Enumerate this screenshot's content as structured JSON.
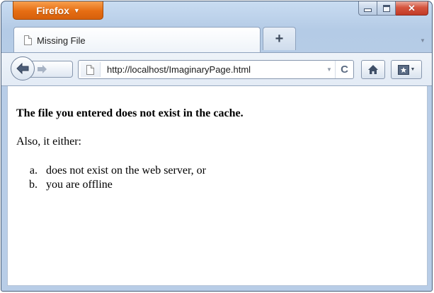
{
  "window": {
    "app_button_label": "Firefox",
    "controls": {
      "minimize": "minimize",
      "maximize": "maximize",
      "close": "close"
    }
  },
  "tabs": [
    {
      "title": "Missing File",
      "icon": "page-icon",
      "active": true
    }
  ],
  "new_tab": {
    "label": "+"
  },
  "navbar": {
    "url": "http://localhost/ImaginaryPage.html",
    "reload_glyph": "C",
    "icons": [
      "back-arrow-icon",
      "forward-arrow-icon",
      "page-icon",
      "reload-icon",
      "home-icon",
      "bookmarks-icon"
    ]
  },
  "page": {
    "heading": "The file you entered does not exist in the cache.",
    "intro": "Also, it either:",
    "reasons": [
      {
        "marker": "a.",
        "text": "does not exist on the web server, or"
      },
      {
        "marker": "b.",
        "text": "you are offline"
      }
    ]
  },
  "colors": {
    "app_button": "#e66d13",
    "close_button": "#c13a26",
    "chrome": "#b8cde7"
  }
}
